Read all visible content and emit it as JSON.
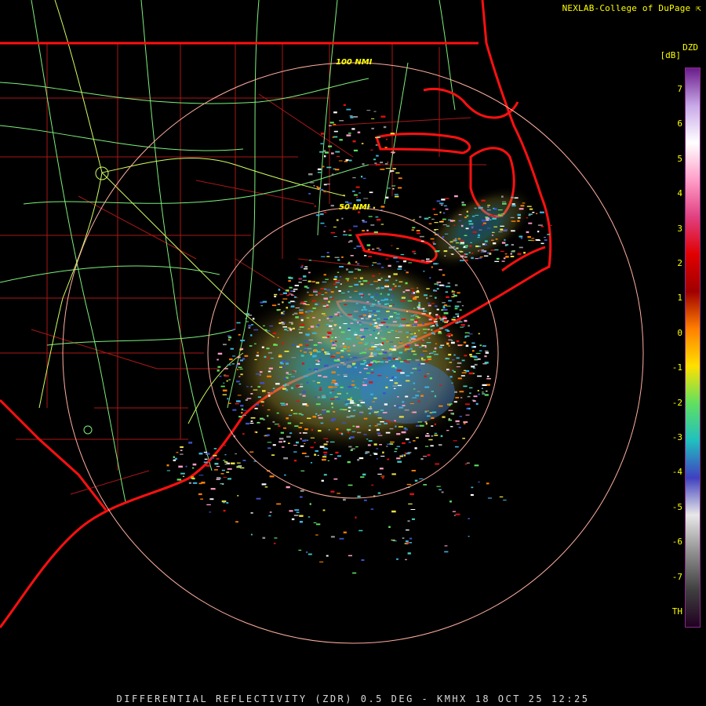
{
  "header": {
    "credit": "NEXLAB-College of DuPage"
  },
  "footer": {
    "caption": "DIFFERENTIAL REFLECTIVITY (ZDR) 0.5 DEG - KMHX 18 OCT 25 12:25"
  },
  "legend": {
    "product": "DZD",
    "unit": "[dB]",
    "ticks": [
      "7",
      "6",
      "5",
      "4",
      "3",
      "2",
      "1",
      "0",
      "-1",
      "-2",
      "-3",
      "-4",
      "-5",
      "-6",
      "-7",
      "TH"
    ],
    "gradient_colors": [
      "#6a1c8a",
      "#c8a8e8",
      "#ffffff",
      "#ff9ec8",
      "#e04080",
      "#e00000",
      "#a00000",
      "#ff8000",
      "#ffe000",
      "#60e060",
      "#20c0c0",
      "#4040c0",
      "#e8e8e8",
      "#909090",
      "#404040",
      "#200020"
    ]
  },
  "map": {
    "range_rings": [
      "50 NMI",
      "100 NMI"
    ],
    "colors": {
      "state_border": "#ff1010",
      "county_lines": "#b01010",
      "highways": "#80ff80",
      "range_ring": "#ffb0a0"
    }
  }
}
